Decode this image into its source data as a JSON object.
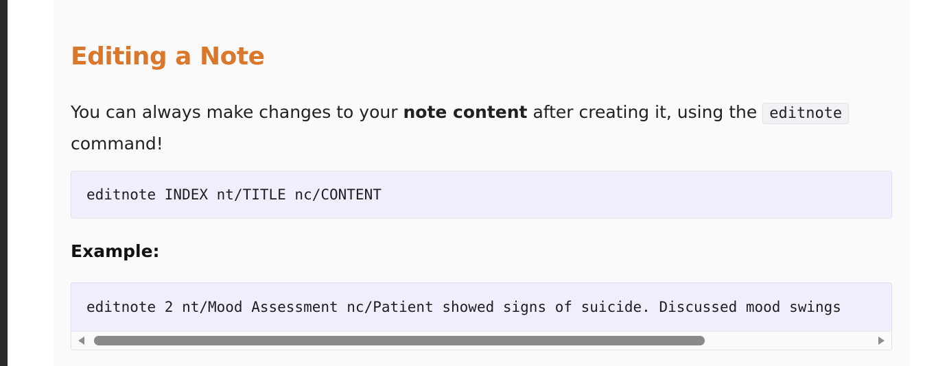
{
  "section": {
    "title": "Editing a Note",
    "intro_before": "You can always make changes to your ",
    "intro_bold": "note content",
    "intro_middle": " after creating it, using the ",
    "intro_code": "editnote",
    "intro_after": " command!",
    "syntax_code": "editnote INDEX nt/TITLE nc/CONTENT",
    "example_label": "Example:",
    "example_code": "editnote 2 nt/Mood Assessment nc/Patient showed signs of suicide. Discussed mood swings"
  },
  "icons": {
    "scroll_left": "arrow-left-icon",
    "scroll_right": "arrow-right-icon"
  }
}
